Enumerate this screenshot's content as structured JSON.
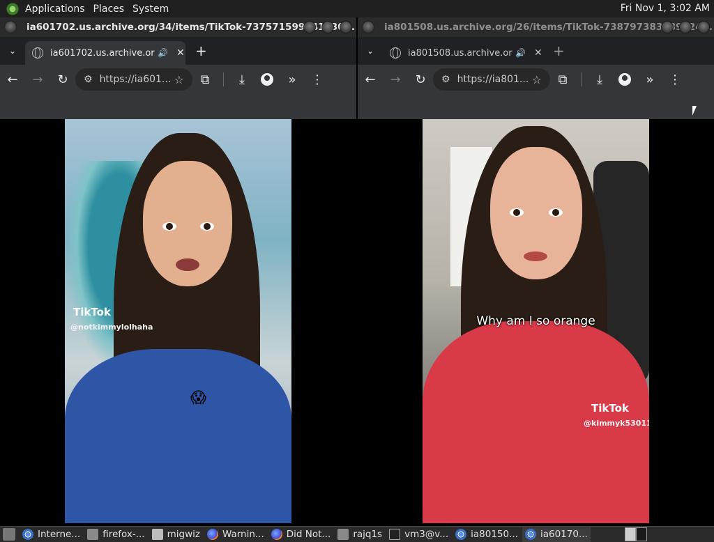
{
  "topbar": {
    "menus": [
      "Applications",
      "Places",
      "System"
    ],
    "clock": "Fri Nov  1,  3:02 AM"
  },
  "left_window": {
    "title": "ia601702.us.archive.org/34/items/TikTok-737571599941430...",
    "tab_label": "ia601702.us.archive.org/3",
    "url": "https://ia601...",
    "video": {
      "tiktok_logo": "TikTok",
      "username": "@notkimmylolhaha",
      "emoji": "😱"
    }
  },
  "right_window": {
    "title": "ia801508.us.archive.org/26/items/TikTok-738797383789324...",
    "tab_label": "ia801508.us.archive.org/",
    "url": "https://ia801...",
    "video": {
      "caption": "Why am I so orange",
      "tiktok_logo": "TikTok",
      "username": "@kimmyk53011"
    }
  },
  "taskbar": {
    "items": [
      {
        "label": "Interne...",
        "icon": "chrome"
      },
      {
        "label": "firefox-...",
        "icon": "app"
      },
      {
        "label": "migwiz",
        "icon": "folder"
      },
      {
        "label": "Warnin...",
        "icon": "firefox"
      },
      {
        "label": "Did Not...",
        "icon": "firefox"
      },
      {
        "label": "rajq1s",
        "icon": "app"
      },
      {
        "label": "vm3@v...",
        "icon": "term"
      },
      {
        "label": "ia80150...",
        "icon": "chrome"
      },
      {
        "label": "ia60170...",
        "icon": "chrome"
      }
    ]
  }
}
